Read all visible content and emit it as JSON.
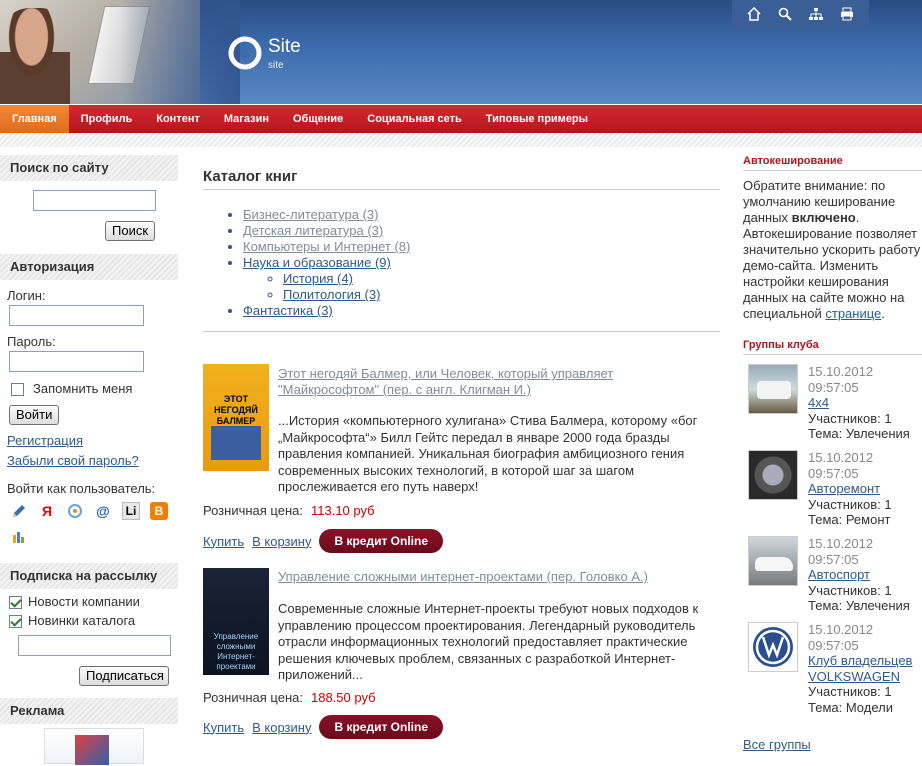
{
  "header": {
    "site_title": "Site",
    "site_sub": "site",
    "toolbar": [
      {
        "icon": "home-icon"
      },
      {
        "icon": "search-icon"
      },
      {
        "icon": "sitemap-icon"
      },
      {
        "icon": "print-icon"
      }
    ]
  },
  "nav": {
    "items": [
      "Главная",
      "Профиль",
      "Контент",
      "Магазин",
      "Общение",
      "Социальная сеть",
      "Типовые примеры"
    ],
    "active": 0
  },
  "search_block": {
    "title": "Поиск по сайту",
    "button": "Поиск",
    "value": ""
  },
  "auth_block": {
    "title": "Авторизация",
    "login_label": "Логин:",
    "password_label": "Пароль:",
    "remember_label": "Запомнить меня",
    "submit": "Войти",
    "register_link": "Регистрация",
    "forgot_link": "Забыли свой пароль?",
    "login_as": "Войти как пользователь:",
    "providers": [
      "pencil-icon",
      "yandex-icon",
      "openid-icon",
      "mail-at-icon",
      "livejournal-icon",
      "blogger-icon",
      "liveinternet-icon"
    ]
  },
  "subscribe_block": {
    "title": "Подписка на рассылку",
    "options": [
      {
        "label": "Новости компании",
        "checked": true
      },
      {
        "label": "Новинки каталога",
        "checked": true
      }
    ],
    "button": "Подписаться"
  },
  "ads_block": {
    "title": "Реклама"
  },
  "main": {
    "title": "Каталог книг",
    "categories": [
      {
        "label": "Бизнес-литература (3)",
        "muted": true
      },
      {
        "label": "Детская литература (3)",
        "muted": true
      },
      {
        "label": "Компьютеры и Интернет (8)",
        "muted": true
      },
      {
        "label": "Наука и образование (9)",
        "muted": false,
        "children": [
          "История (4)",
          "Политология (3)"
        ]
      },
      {
        "label": "Фантастика (3)",
        "muted": false
      }
    ],
    "books": [
      {
        "title_line1": "Этот негодяй Балмер, или Человек, который управляет",
        "title_line2": "\"Майкрософтом\" (пер. с англ. Клигман И.)",
        "desc": "...История «компьютерного хулигана» Стива Балмера, которому «бог „Майкрософта“» Билл Гейтс передал в январе 2000 года бразды правления компанией. Уникальная биография амбициозного гения современных высоких технологий, в которой шаг за шагом прослеживается его путь наверх!",
        "price_label": "Розничная цена:",
        "price": "113.10 руб",
        "buy": "Купить",
        "cart": "В корзину",
        "credit": "В кредит Online",
        "cover_text": "ЭТОТ НЕГОДЯЙ БАЛМЕР"
      },
      {
        "title_line1": "Управление сложными интернет-проектами (пер. Головко А.)",
        "title_line2": "",
        "desc": "Современные сложные Интернет-проекты требуют новых подходов к управлению процессом проектирования. Легендарный руководитель отрасли информационных технологий предоставляет практические решения ключевых проблем, связанных с разработкой Интернет-приложений...",
        "price_label": "Розничная цена:",
        "price": "188.50 руб",
        "buy": "Купить",
        "cart": "В корзину",
        "credit": "В кредит Online",
        "cover_text": "Управление сложными Интернет-проектами"
      }
    ]
  },
  "right": {
    "cache_title": "Автокеширование",
    "cache_text_1": "Обратите внимание: по умолчанию кеширование данных ",
    "cache_text_bold": "включено",
    "cache_text_2": ". Автокеширование позволяет значительно ускорить работу демо-сайта. Изменить настройки кеширования данных на сайте можно на специальной ",
    "cache_link": "странице",
    "cache_text_3": ".",
    "groups_title": "Группы клуба",
    "groups": [
      {
        "date": "15.10.2012",
        "time": "09:57:05",
        "name": "4x4",
        "members": "Участников: 1",
        "topic": "Тема: Увлечения",
        "thumb": "suv"
      },
      {
        "date": "15.10.2012",
        "time": "09:57:05",
        "name": "Авторемонт",
        "members": "Участников: 1",
        "topic": "Тема: Ремонт",
        "thumb": "engine"
      },
      {
        "date": "15.10.2012",
        "time": "09:57:05",
        "name": "Автоспорт",
        "members": "Участников: 1",
        "topic": "Тема: Увлечения",
        "thumb": "race"
      },
      {
        "date": "15.10.2012",
        "time": "09:57:05",
        "name": "Клуб владельцев VOLKSWAGEN",
        "members": "Участников: 1",
        "topic": "Тема: Модели",
        "thumb": "vw"
      }
    ],
    "all_groups": "Все группы"
  }
}
